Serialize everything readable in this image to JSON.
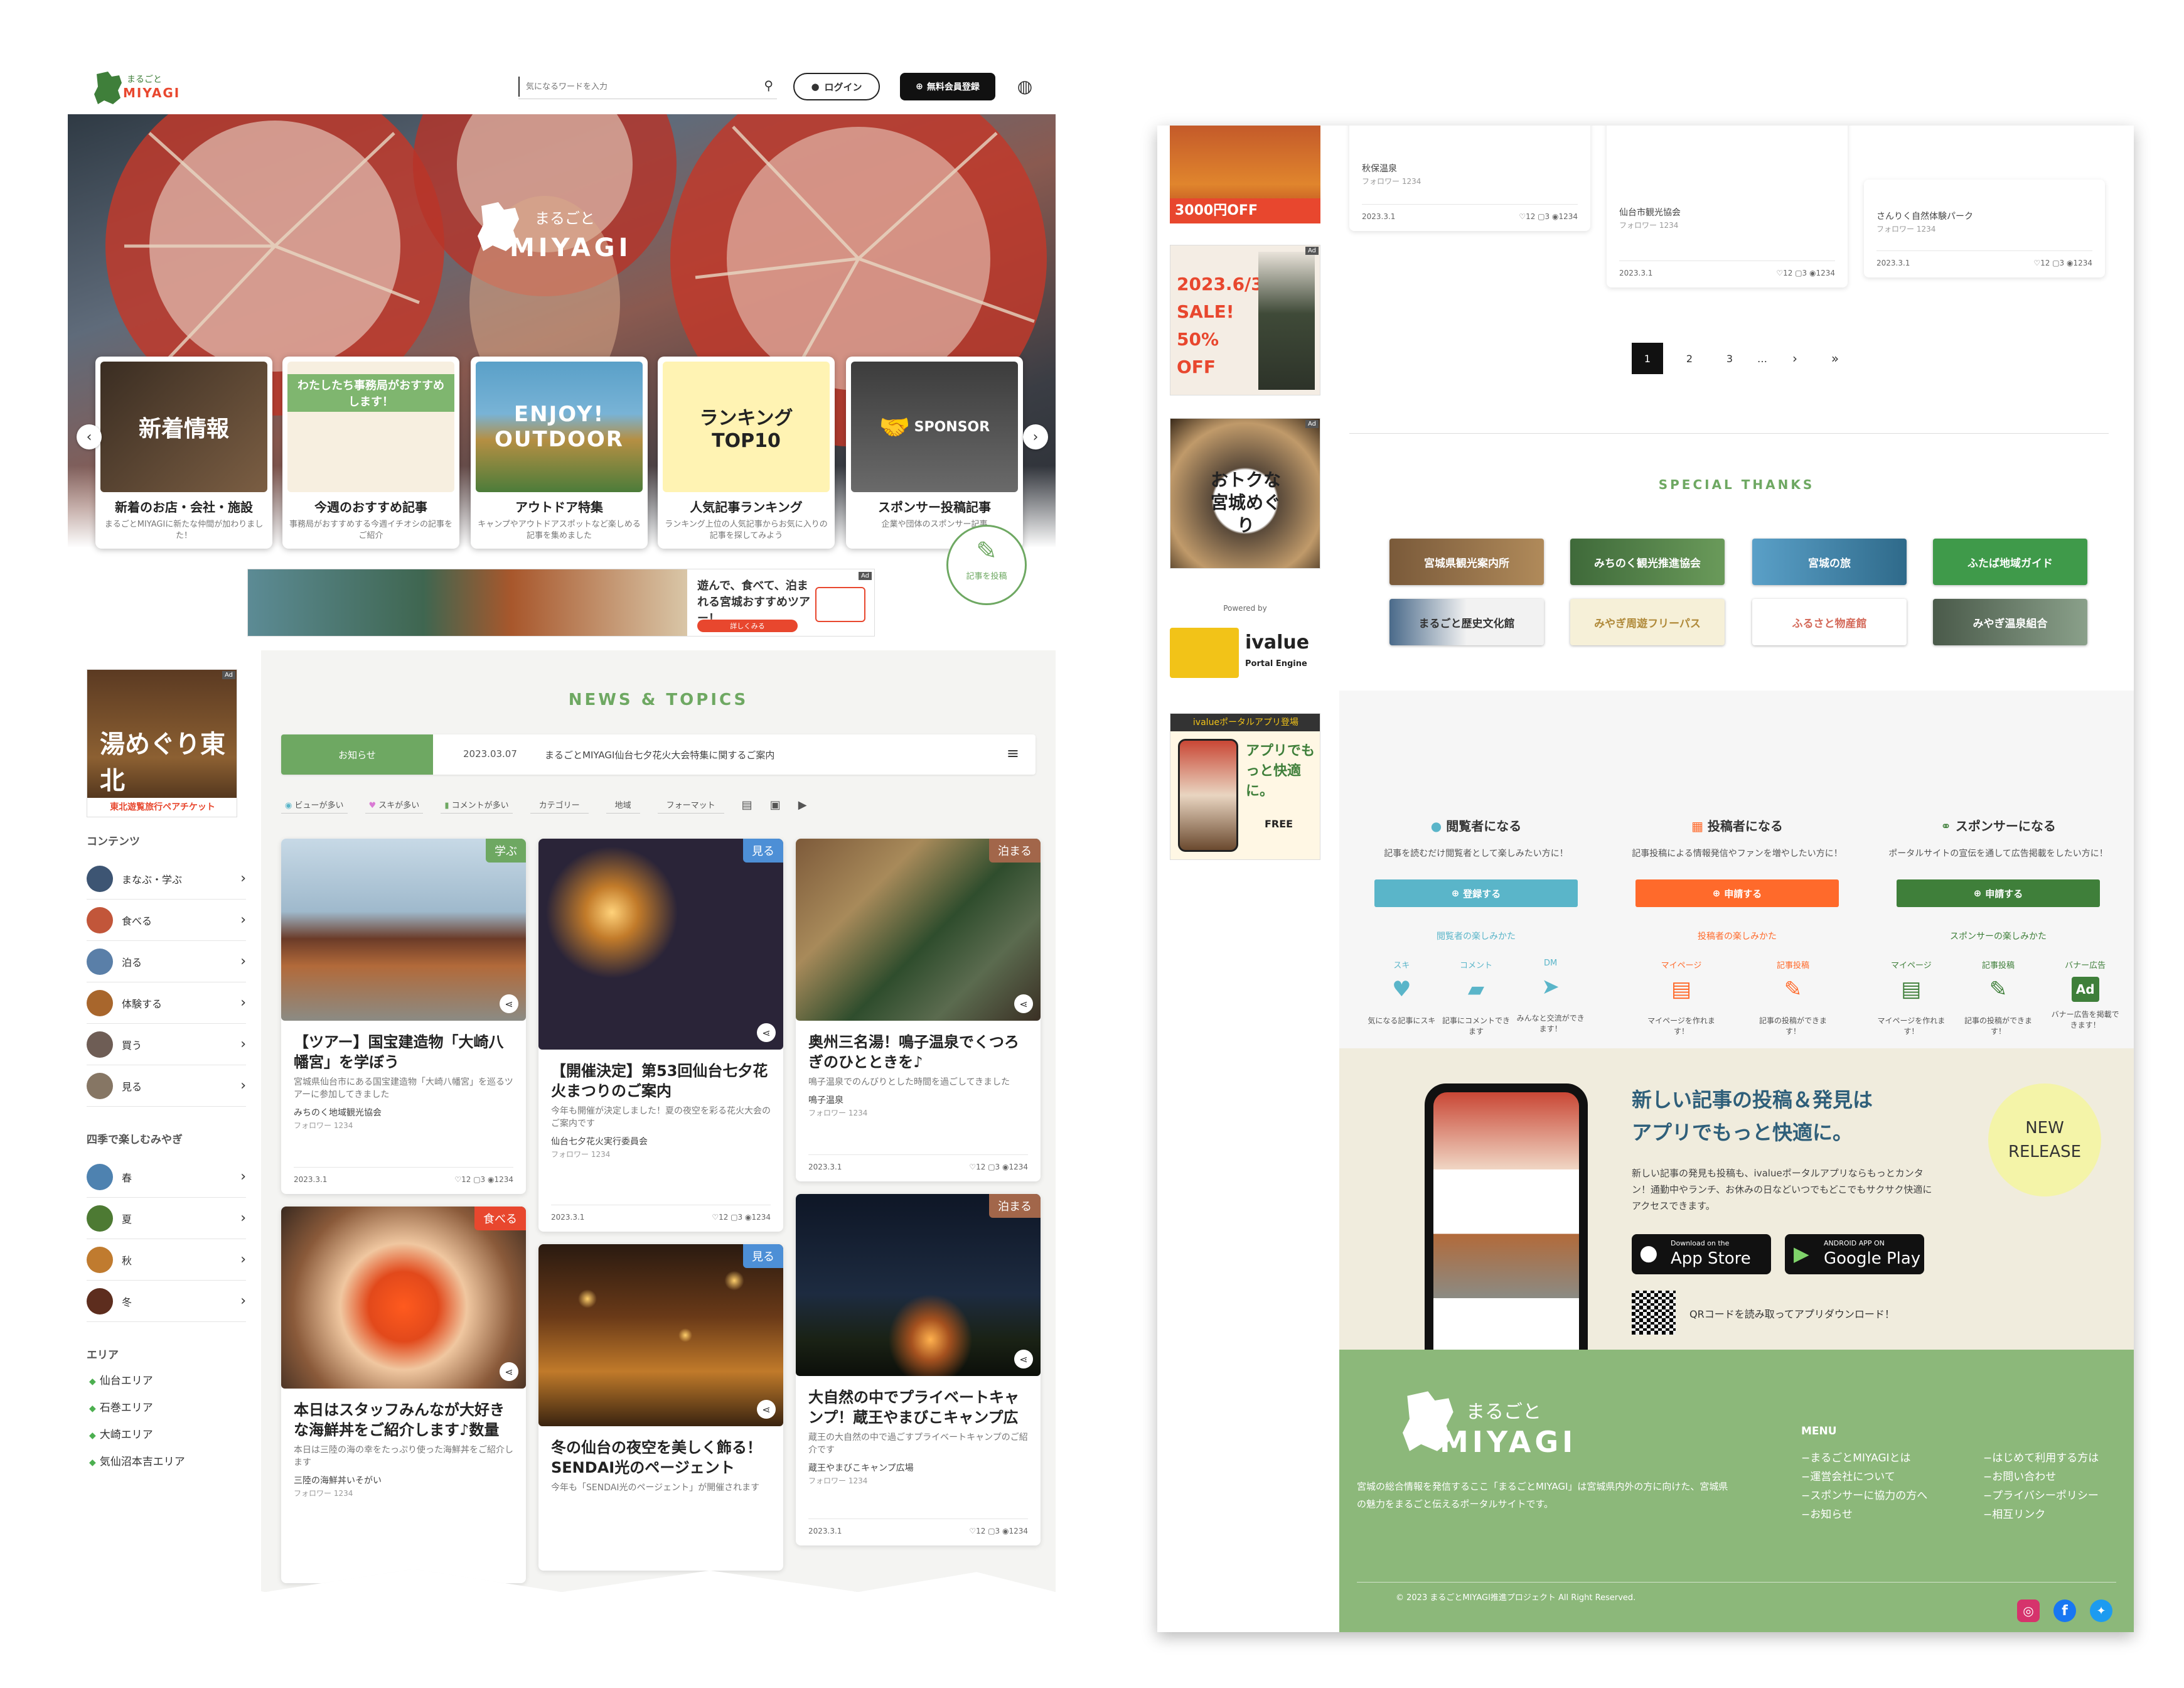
{
  "header": {
    "logo_small": "まるごと",
    "logo_main": "MIYAGI",
    "search_placeholder": "気になるワードを入力",
    "login_label": "ログイン",
    "register_label": "無料会員登録"
  },
  "hero": {
    "logo_small": "まるごと",
    "logo_main": "MIYAGI"
  },
  "tiles": [
    {
      "image": "新着情報",
      "title": "新着のお店・会社・施設",
      "desc": "まるごとMIYAGIに新たな仲間が加わりました！"
    },
    {
      "image": "わたしたち事務局がおすすめします！",
      "title": "今週のおすすめ記事",
      "desc": "事務局がおすすめする今週イチオシの記事をご紹介"
    },
    {
      "image": "ENJOY! OUTDOOR",
      "title": "アウトドア特集",
      "desc": "キャンプやアウトドアスポットなど楽しめる記事を集めました"
    },
    {
      "image": "ランキング TOP10",
      "title": "人気記事ランキング",
      "desc": "ランキング上位の人気記事からお気に入りの記事を探してみよう"
    },
    {
      "image": "SPONSOR",
      "title": "スポンサー投稿記事",
      "desc": "企業や団体のスポンサー記事"
    }
  ],
  "post_button": "記事を投稿",
  "banner_ad": {
    "text": "遊んで、食べて、泊まれる宮城おすすめツアー！",
    "cta": "詳しくみる",
    "tag": "Ad"
  },
  "sidebar": {
    "ad_title": "湯めぐり東北",
    "ad_sub": "東北遊覧旅行ペアチケット",
    "ad_tag": "Ad",
    "contents_heading": "コンテンツ",
    "contents": [
      "まなぶ・学ぶ",
      "食べる",
      "泊る",
      "体験する",
      "買う",
      "見る"
    ],
    "seasons_heading": "四季で楽しむみやぎ",
    "seasons": [
      "春",
      "夏",
      "秋",
      "冬"
    ],
    "areas_heading": "エリア",
    "areas": [
      "仙台エリア",
      "石巻エリア",
      "大崎エリア",
      "気仙沼本吉エリア"
    ]
  },
  "news": {
    "heading": "NEWS & TOPICS",
    "tab_label": "お知らせ",
    "date": "2023.03.07",
    "notice": "まるごとMIYAGI仙台七夕花火大会特集に関するご案内",
    "filters": [
      "ビューが多い",
      "スキが多い",
      "コメントが多い",
      "カテゴリー",
      "地域",
      "フォーマット"
    ]
  },
  "cards": [
    {
      "badge": "学ぶ",
      "title": "【ツアー】国宝建造物「大崎八幡宮」を学ぼう",
      "desc": "宮城県仙台市にある国宝建造物「大崎八幡宮」を巡るツアーに参加してきました",
      "author": "みちのく地域観光協会",
      "followers": "フォロワー 1234",
      "date": "2023.3.1",
      "stats": "♡12 ▢3 ◉1234"
    },
    {
      "badge": "見る",
      "title": "【開催決定】第53回仙台七夕花火まつりのご案内",
      "desc": "今年も開催が決定しました！夏の夜空を彩る花火大会のご案内です",
      "author": "仙台七夕花火実行委員会",
      "followers": "フォロワー 1234",
      "date": "2023.3.1",
      "stats": "♡12 ▢3 ◉1234"
    },
    {
      "badge": "泊まる",
      "title": "奥州三名湯！鳴子温泉でくつろぎのひとときを♪",
      "desc": "鳴子温泉でのんびりとした時間を過ごしてきました",
      "author": "鳴子温泉",
      "followers": "フォロワー 1234",
      "date": "2023.3.1",
      "stats": "♡12 ▢3 ◉1234"
    },
    {
      "badge": "食べる",
      "title": "本日はスタッフみんなが大好きな海鮮丼をご紹介します♪数量",
      "desc": "本日は三陸の海の幸をたっぷり使った海鮮丼をご紹介します",
      "author": "三陸の海鮮丼いそがい",
      "followers": "フォロワー 1234",
      "date": "2023.3.1",
      "stats": "♡12 ▢3 ◉1234"
    },
    {
      "badge": "見る",
      "title": "冬の仙台の夜空を美しく飾る！SENDAI光のページェント",
      "desc": "今年も「SENDAI光のページェント」が開催されます",
      "author": "",
      "followers": "",
      "date": "",
      "stats": ""
    },
    {
      "badge": "泊まる",
      "title": "大自然の中でプライベートキャンプ！蔵王やまびこキャンプ広",
      "desc": "蔵王の大自然の中で過ごすプライベートキャンプのご紹介です",
      "author": "蔵王やまびこキャンプ広場",
      "followers": "フォロワー 1234",
      "date": "2023.3.1",
      "stats": "♡12 ▢3 ◉1234"
    }
  ],
  "right": {
    "side_ads": [
      {
        "title": "3000円OFF",
        "tag": "Ad"
      },
      {
        "title": "2023.6/30 SALE! 50% OFF",
        "tag": "Ad"
      },
      {
        "title": "おトクな宮城めぐり",
        "tag": "Ad"
      }
    ],
    "powered_by": "Powered by",
    "ivalue": "ivalue",
    "ivalue_sub": "Portal Engine",
    "app_ad_title": "ivalueポータルアプリ登場",
    "app_ad_text": "アプリでもっと快適に。",
    "app_ad_free": "FREE",
    "top_cards": [
      {
        "author": "秋保温泉",
        "followers": "フォロワー 1234",
        "date": "2023.3.1",
        "stats": "♡12 ▢3 ◉1234"
      },
      {
        "author": "仙台市観光協会",
        "followers": "フォロワー 1234",
        "date": "2023.3.1",
        "stats": "♡12 ▢3 ◉1234"
      },
      {
        "author": "さんりく自然体験パーク",
        "followers": "フォロワー 1234",
        "date": "2023.3.1",
        "stats": "♡12 ▢3 ◉1234"
      }
    ],
    "pagination": [
      "1",
      "2",
      "3",
      "…",
      "›",
      "»"
    ],
    "thanks_heading": "SPECIAL THANKS",
    "thanks": [
      "宮城県観光案内所",
      "みちのく観光推進協会",
      "宮城の旅",
      "ふたば地域ガイド",
      "まるごと歴史文化館",
      "みやぎ周遊フリーパス",
      "ふるさと物産館",
      "みやぎ温泉組合"
    ],
    "roles": [
      {
        "title": "閲覧者になる",
        "desc": "記事を読むだけ閲覧者として楽しみたい方に！",
        "button": "登録する",
        "howto": "閲覧者の楽しみかた",
        "feats": [
          {
            "label": "スキ",
            "desc": "気になる記事にスキ"
          },
          {
            "label": "コメント",
            "desc": "記事にコメントできます"
          },
          {
            "label": "DM",
            "desc": "みんなと交流ができます！"
          }
        ]
      },
      {
        "title": "投稿者になる",
        "desc": "記事投稿による情報発信やファンを増やしたい方に！",
        "button": "申請する",
        "howto": "投稿者の楽しみかた",
        "feats": [
          {
            "label": "マイページ",
            "desc": "マイページを作れます！"
          },
          {
            "label": "記事投稿",
            "desc": "記事の投稿ができます！"
          }
        ]
      },
      {
        "title": "スポンサーになる",
        "desc": "ポータルサイトの宣伝を通して広告掲載をしたい方に！",
        "button": "申請する",
        "howto": "スポンサーの楽しみかた",
        "feats": [
          {
            "label": "マイページ",
            "desc": "マイページを作れます！"
          },
          {
            "label": "記事投稿",
            "desc": "記事の投稿ができます！"
          },
          {
            "label": "バナー広告",
            "desc": "バナー広告を掲載できます！"
          }
        ]
      }
    ],
    "app": {
      "title1": "新しい記事の投稿＆発見は",
      "title2": "アプリでもっと快適に。",
      "desc": "新しい記事の発見も投稿も、ivalueポータルアプリならもっとカンタン！通勤中やランチ、お休みの日などいつでもどこでもサクサク快適にアクセスできます。",
      "appstore_small": "Download on the",
      "appstore": "App Store",
      "gplay_small": "ANDROID APP ON",
      "gplay": "Google Play",
      "qr_text": "QRコードを読み取ってアプリダウンロード！",
      "new_release": "NEW RELEASE"
    },
    "footer": {
      "logo_small": "まるごと",
      "logo_main": "MIYAGI",
      "desc": "宮城の総合情報を発信するここ「まるごとMIYAGI」は宮城県内外の方に向けた、宮城県の魅力をまるごと伝えるポータルサイトです。",
      "menu_heading": "MENU",
      "menu_col1": [
        "−まるごとMIYAGIとは",
        "−運営会社について",
        "−スポンサーに協力の方へ",
        "−お知らせ"
      ],
      "menu_col2": [
        "−はじめて利用する方は",
        "−お問い合わせ",
        "−プライバシーポリシー",
        "−相互リンク"
      ],
      "copyright": "© 2023 まるごとMIYAGI推進プロジェクト All Right Reserved."
    }
  },
  "colors": {
    "green": "#6ea862",
    "dark_green": "#3f7f3a",
    "orange": "#ff6a2b",
    "blue": "#5ab5c9",
    "beige": "#f0ecdd",
    "footer_green": "#8cb87a",
    "red": "#e8472e"
  }
}
